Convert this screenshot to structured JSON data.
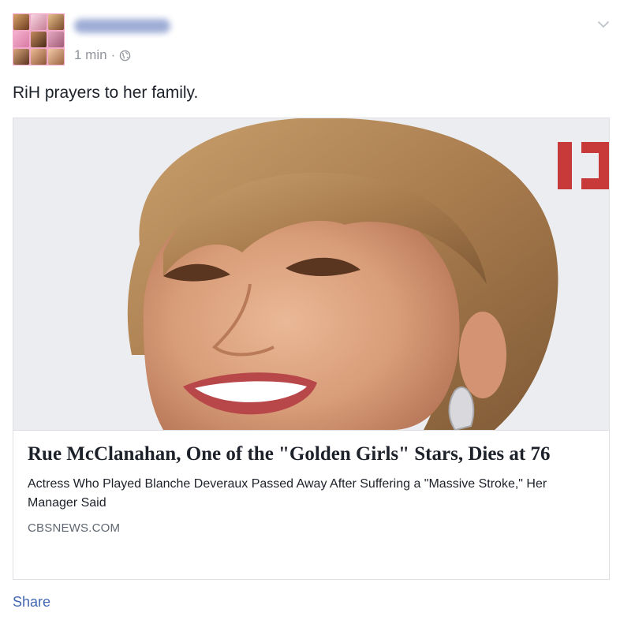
{
  "post": {
    "author": {
      "name": "Trina Clark"
    },
    "timestamp": "1 min",
    "separator": "·",
    "privacy_icon": "globe-icon",
    "options_icon": "chevron-down-icon",
    "message": "RiH prayers to her family."
  },
  "link_card": {
    "image_alt": "Rue McClanahan smiling",
    "headline": "Rue McClanahan, One of the \"Golden Girls\" Stars, Dies at 76",
    "description": "Actress Who Played Blanche Deveraux Passed Away After Suffering a \"Massive Stroke,\" Her Manager Said",
    "source": "CBSNEWS.COM"
  },
  "actions": {
    "share_label": "Share"
  },
  "colors": {
    "link_blue": "#4267b2",
    "meta_gray": "#90949c",
    "source_gray": "#606770",
    "border": "#dddfe2"
  }
}
